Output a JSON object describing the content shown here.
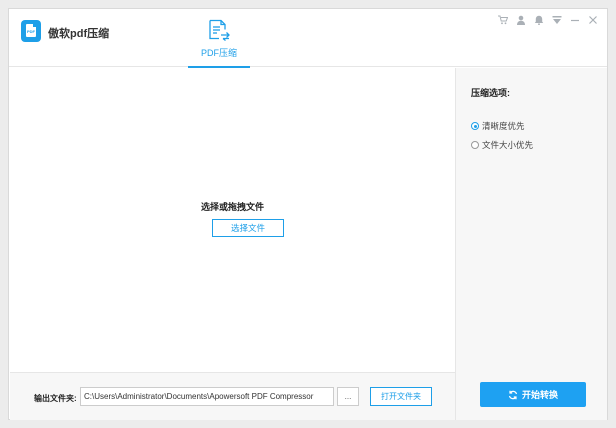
{
  "app": {
    "title": "傲软pdf压缩",
    "logo_text": "PDF"
  },
  "tab": {
    "label": "PDF压缩"
  },
  "window_controls": [
    "cart-icon",
    "user-icon",
    "bell-icon",
    "menu-icon",
    "minimize-icon",
    "close-icon"
  ],
  "drop_zone": {
    "prompt": "选择或拖拽文件",
    "select_button": "选择文件"
  },
  "options": {
    "title": "压缩选项:",
    "items": [
      {
        "label": "清晰度优先",
        "selected": true
      },
      {
        "label": "文件大小优先",
        "selected": false
      }
    ],
    "start_button": "开始转换"
  },
  "footer": {
    "output_label": "输出文件夹:",
    "output_path": "C:\\Users\\Administrator\\Documents\\Apowersoft PDF Compressor",
    "browse_button": "...",
    "open_folder_button": "打开文件夹"
  },
  "colors": {
    "accent": "#1e9fe8",
    "start_button": "#1ea1f2"
  }
}
